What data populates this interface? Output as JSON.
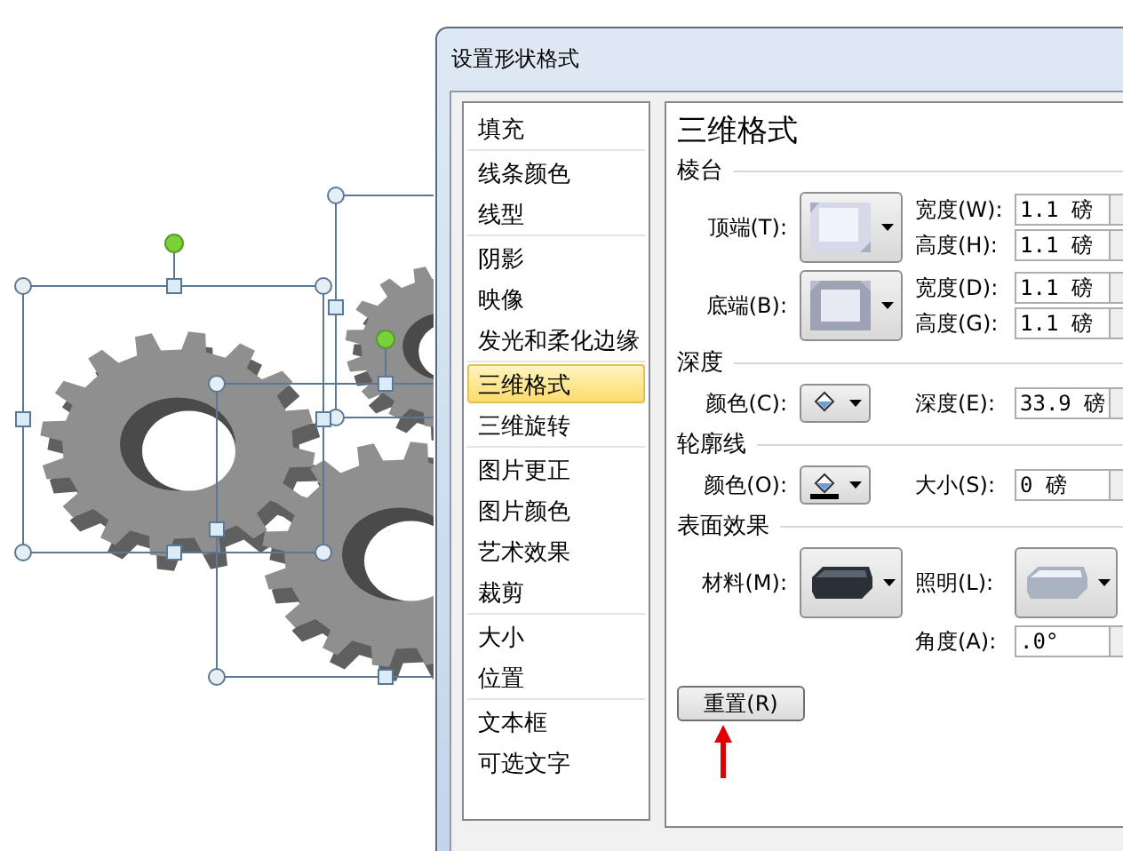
{
  "dialog": {
    "title": "设置形状格式"
  },
  "nav_groups": [
    [
      {
        "label": "填充",
        "selected": false
      }
    ],
    [
      {
        "label": "线条颜色",
        "selected": false
      },
      {
        "label": "线型",
        "selected": false
      }
    ],
    [
      {
        "label": "阴影",
        "selected": false
      },
      {
        "label": "映像",
        "selected": false
      },
      {
        "label": "发光和柔化边缘",
        "selected": false
      }
    ],
    [
      {
        "label": "三维格式",
        "selected": true
      },
      {
        "label": "三维旋转",
        "selected": false
      }
    ],
    [
      {
        "label": "图片更正",
        "selected": false
      },
      {
        "label": "图片颜色",
        "selected": false
      },
      {
        "label": "艺术效果",
        "selected": false
      },
      {
        "label": "裁剪",
        "selected": false
      }
    ],
    [
      {
        "label": "大小",
        "selected": false
      },
      {
        "label": "位置",
        "selected": false
      }
    ],
    [
      {
        "label": "文本框",
        "selected": false
      },
      {
        "label": "可选文字",
        "selected": false
      }
    ]
  ],
  "panel": {
    "title": "三维格式",
    "sections": [
      {
        "heading": "棱台",
        "rows": [
          {
            "label": "顶端(T):",
            "kind": "bevel-top",
            "fields": [
              {
                "kind": "spin",
                "label": "宽度(W):",
                "value": "1.1 磅"
              },
              {
                "kind": "spin",
                "label": "高度(H):",
                "value": "1.1 磅"
              }
            ]
          },
          {
            "label": "底端(B):",
            "kind": "bevel-bottom",
            "fields": [
              {
                "kind": "spin",
                "label": "宽度(D):",
                "value": "1.1 磅"
              },
              {
                "kind": "spin",
                "label": "高度(G):",
                "value": "1.1 磅"
              }
            ]
          }
        ]
      },
      {
        "heading": "深度",
        "rows": [
          {
            "label": "颜色(C):",
            "kind": "fill-color",
            "fields": [
              {
                "kind": "spin",
                "label": "深度(E):",
                "value": "33.9 磅"
              }
            ]
          }
        ]
      },
      {
        "heading": "轮廓线",
        "rows": [
          {
            "label": "颜色(O):",
            "kind": "line-color",
            "fields": [
              {
                "kind": "spin",
                "label": "大小(S):",
                "value": "0 磅"
              }
            ]
          }
        ]
      },
      {
        "heading": "表面效果",
        "rows": [
          {
            "label": "材料(M):",
            "kind": "material",
            "fields": [
              {
                "kind": "picker",
                "label": "照明(L):"
              }
            ]
          },
          {
            "kind": "blank",
            "fields": [
              {
                "kind": "spin",
                "label": "角度(A):",
                "value": ".0°"
              }
            ]
          }
        ]
      }
    ],
    "reset_button": "重置(R)"
  }
}
